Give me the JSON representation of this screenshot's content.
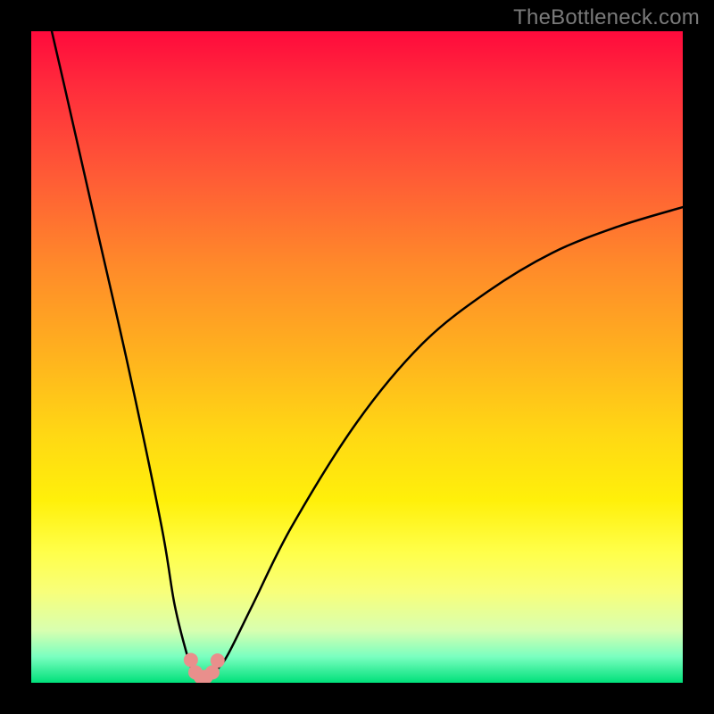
{
  "watermark": "TheBottleneck.com",
  "chart_data": {
    "type": "line",
    "title": "",
    "xlabel": "",
    "ylabel": "",
    "xlim": [
      0,
      100
    ],
    "ylim": [
      0,
      100
    ],
    "grid": false,
    "series": [
      {
        "name": "bottleneck-curve",
        "x": [
          2,
          5,
          10,
          15,
          20,
          22,
          24,
          25,
          26,
          27,
          28,
          30,
          34,
          40,
          50,
          60,
          70,
          80,
          90,
          100
        ],
        "y": [
          105,
          92,
          70,
          48,
          24,
          12,
          4,
          1.5,
          0.8,
          0.8,
          1.6,
          4,
          12,
          24,
          40,
          52,
          60,
          66,
          70,
          73
        ]
      }
    ],
    "markers": {
      "name": "highlight-dots",
      "x": [
        24.5,
        25.2,
        26.0,
        26.8,
        27.8,
        28.6
      ],
      "y": [
        3.5,
        1.6,
        0.9,
        0.9,
        1.6,
        3.4
      ]
    },
    "gradient_stops": [
      {
        "pos": 0.0,
        "color": "#ff0a3c"
      },
      {
        "pos": 0.5,
        "color": "#ffb31e"
      },
      {
        "pos": 0.8,
        "color": "#ffff4a"
      },
      {
        "pos": 1.0,
        "color": "#00e07a"
      }
    ]
  }
}
